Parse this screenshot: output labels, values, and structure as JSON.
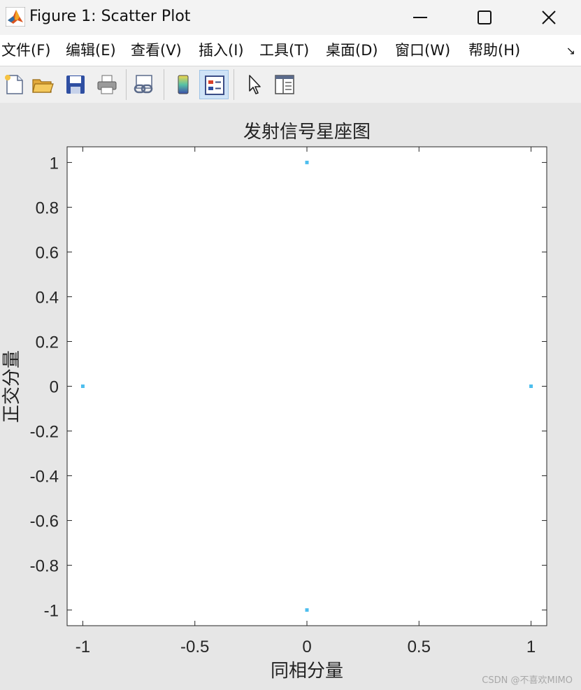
{
  "window": {
    "title": "Figure 1: Scatter Plot"
  },
  "menubar": {
    "items": [
      "文件(F)",
      "编辑(E)",
      "查看(V)",
      "插入(I)",
      "工具(T)",
      "桌面(D)",
      "窗口(W)",
      "帮助(H)"
    ]
  },
  "toolbar": {
    "buttons": [
      "new-figure-icon",
      "open-file-icon",
      "save-icon",
      "print-icon",
      "link-plot-icon",
      "colorbar-icon",
      "legend-icon",
      "edit-plot-pointer-icon",
      "property-inspector-icon"
    ],
    "active": "legend-icon"
  },
  "chart_data": {
    "type": "scatter",
    "title": "发射信号星座图",
    "xlabel": "同相分量",
    "ylabel": "正交分量",
    "xlim": [
      -1.07,
      1.07
    ],
    "ylim": [
      -1.07,
      1.07
    ],
    "xticks": [
      -1,
      -0.5,
      0,
      0.5,
      1
    ],
    "xtick_labels": [
      "-1",
      "-0.5",
      "0",
      "0.5",
      "1"
    ],
    "yticks": [
      1,
      0.8,
      0.6,
      0.4,
      0.2,
      0,
      -0.2,
      -0.4,
      -0.6,
      -0.8,
      -1
    ],
    "ytick_labels": [
      "1",
      "0.8",
      "0.6",
      "0.4",
      "0.2",
      "0",
      "-0.2",
      "-0.4",
      "-0.6",
      "-0.8",
      "-1"
    ],
    "grid": false,
    "marker_color": "#4dbeee",
    "series": [
      {
        "x": [
          1,
          0,
          -1,
          0
        ],
        "y": [
          0,
          1,
          0,
          -1
        ]
      }
    ]
  },
  "watermark": "CSDN @不喜欢MIMO"
}
